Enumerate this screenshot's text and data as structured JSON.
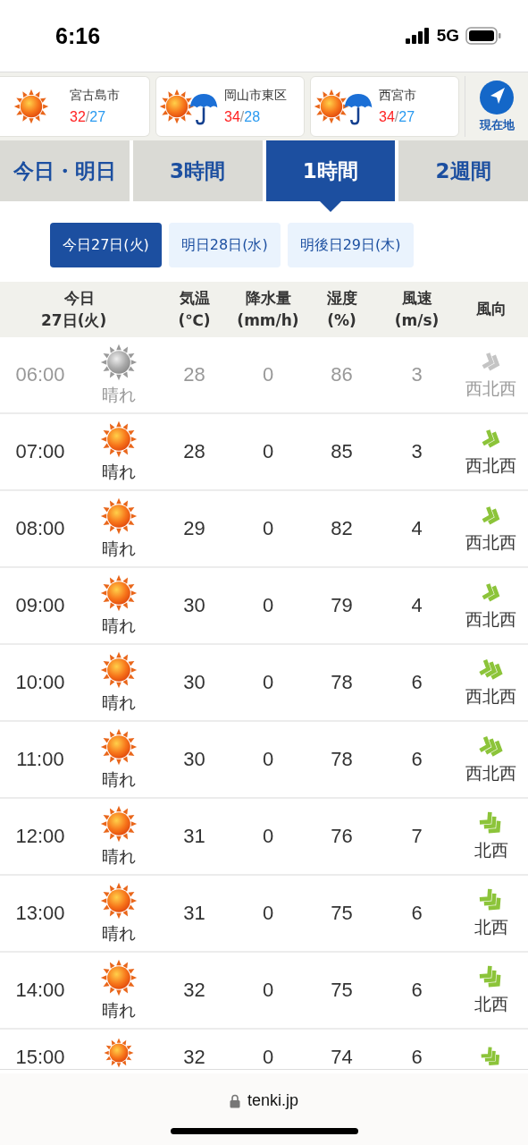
{
  "status_bar": {
    "time": "6:16",
    "network": "5G"
  },
  "locations": [
    {
      "name": "宮古島市",
      "rain": false,
      "high": "32",
      "separator": "/",
      "low": "27"
    },
    {
      "name": "岡山市東区",
      "rain": true,
      "high": "34",
      "separator": "/",
      "low": "28"
    },
    {
      "name": "西宮市",
      "rain": true,
      "high": "34",
      "separator": "/",
      "low": "27"
    }
  ],
  "current_location": {
    "label": "現在地"
  },
  "tabs": [
    {
      "label": "今日・明日",
      "selected": false
    },
    {
      "label": "3時間",
      "selected": false
    },
    {
      "label": "1時間",
      "selected": true
    },
    {
      "label": "2週間",
      "selected": false
    }
  ],
  "days": [
    {
      "label": "今日27日(火)",
      "selected": true
    },
    {
      "label": "明日28日(水)",
      "selected": false
    },
    {
      "label": "明後日29日(木)",
      "selected": false
    }
  ],
  "table": {
    "columns": [
      [
        "今日",
        "27日(火)"
      ],
      [
        "気温",
        "(℃)"
      ],
      [
        "降水量",
        "(mm/h)"
      ],
      [
        "湿度",
        "(%)"
      ],
      [
        "風速",
        "(m/s)"
      ],
      [
        "風向"
      ]
    ],
    "rows": [
      {
        "time": "06:00",
        "past": true,
        "weather": "晴れ",
        "temp": "28",
        "precip": "0",
        "humidity": "86",
        "wind_speed": "3",
        "strong_wind": false,
        "steep_arrow": false,
        "direction": "西北西"
      },
      {
        "time": "07:00",
        "past": false,
        "weather": "晴れ",
        "temp": "28",
        "precip": "0",
        "humidity": "85",
        "wind_speed": "3",
        "strong_wind": false,
        "steep_arrow": false,
        "direction": "西北西"
      },
      {
        "time": "08:00",
        "past": false,
        "weather": "晴れ",
        "temp": "29",
        "precip": "0",
        "humidity": "82",
        "wind_speed": "4",
        "strong_wind": false,
        "steep_arrow": false,
        "direction": "西北西"
      },
      {
        "time": "09:00",
        "past": false,
        "weather": "晴れ",
        "temp": "30",
        "precip": "0",
        "humidity": "79",
        "wind_speed": "4",
        "strong_wind": false,
        "steep_arrow": false,
        "direction": "西北西"
      },
      {
        "time": "10:00",
        "past": false,
        "weather": "晴れ",
        "temp": "30",
        "precip": "0",
        "humidity": "78",
        "wind_speed": "6",
        "strong_wind": true,
        "steep_arrow": false,
        "direction": "西北西"
      },
      {
        "time": "11:00",
        "past": false,
        "weather": "晴れ",
        "temp": "30",
        "precip": "0",
        "humidity": "78",
        "wind_speed": "6",
        "strong_wind": true,
        "steep_arrow": false,
        "direction": "西北西"
      },
      {
        "time": "12:00",
        "past": false,
        "weather": "晴れ",
        "temp": "31",
        "precip": "0",
        "humidity": "76",
        "wind_speed": "7",
        "strong_wind": true,
        "steep_arrow": true,
        "direction": "北西"
      },
      {
        "time": "13:00",
        "past": false,
        "weather": "晴れ",
        "temp": "31",
        "precip": "0",
        "humidity": "75",
        "wind_speed": "6",
        "strong_wind": true,
        "steep_arrow": true,
        "direction": "北西"
      },
      {
        "time": "14:00",
        "past": false,
        "weather": "晴れ",
        "temp": "32",
        "precip": "0",
        "humidity": "75",
        "wind_speed": "6",
        "strong_wind": true,
        "steep_arrow": true,
        "direction": "北西"
      },
      {
        "time": "15:00",
        "past": false,
        "temp": "32",
        "precip": "0",
        "humidity": "74",
        "wind_speed": "6",
        "strong_wind": true,
        "steep_arrow": true
      }
    ]
  },
  "address_bar": {
    "domain": "tenki.jp"
  }
}
